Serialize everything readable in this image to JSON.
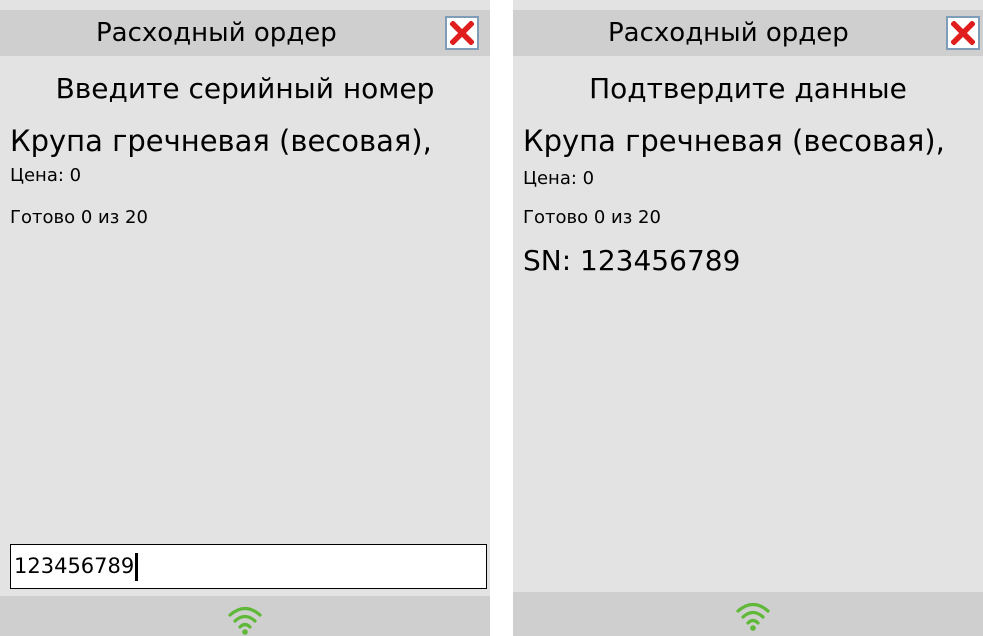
{
  "left_screen": {
    "title": "Расходный ордер",
    "header": "Введите серийный номер",
    "product_name": "Крупа гречневая (весовая),",
    "price_line": "Цена: 0",
    "progress_line": "Готово 0 из 20",
    "input_value": "123456789"
  },
  "right_screen": {
    "title": "Расходный ордер",
    "header": "Подтвердите данные",
    "product_name": "Крупа гречневая (весовая),",
    "price_line": "Цена: 0",
    "progress_line": "Готово 0 из 20",
    "serial_line": "SN: 123456789"
  },
  "icons": {
    "close": "close-icon",
    "wifi": "wifi-icon"
  },
  "colors": {
    "close_red": "#e01e1e",
    "wifi_green": "#5fb838",
    "screen_bg": "#e3e3e3",
    "bar_bg": "#cfcfcf"
  }
}
